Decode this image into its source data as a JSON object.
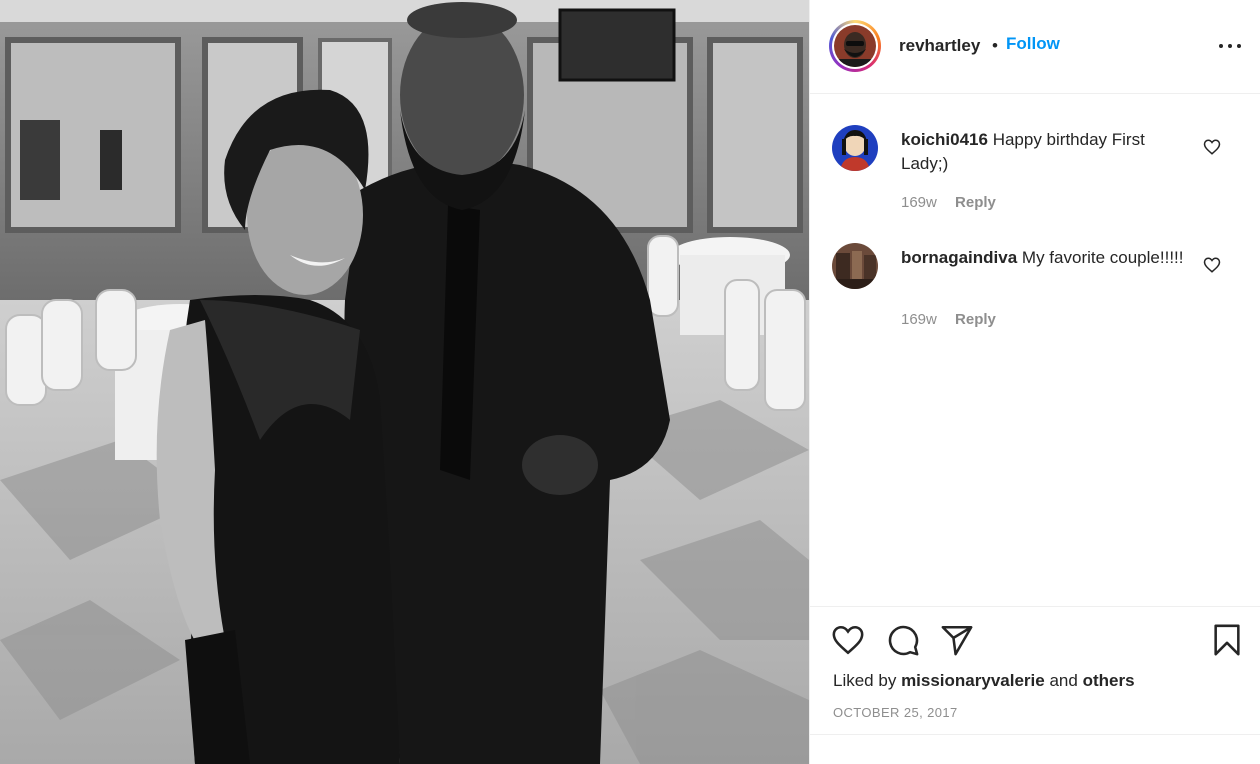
{
  "post": {
    "photo_alt": "",
    "author": {
      "username": "revhartley",
      "separator": "•",
      "follow_label": "Follow"
    },
    "comments": [
      {
        "username": "koichi0416",
        "text": "Happy birthday First Lady;)",
        "age": "169w",
        "reply_label": "Reply"
      },
      {
        "username": "bornagaindiva",
        "text": "My favorite couple!!!!!",
        "age": "169w",
        "reply_label": "Reply"
      }
    ],
    "likes": {
      "prefix": "Liked by",
      "user": "missionaryvalerie",
      "joiner": "and",
      "others": "others"
    },
    "date": "OCTOBER 25, 2017"
  },
  "icons": {
    "more": "more-options-icon",
    "like": "heart-icon",
    "comment": "comment-bubble-icon",
    "share": "paper-plane-icon",
    "save": "bookmark-icon",
    "comment_like": "small-heart-icon"
  },
  "colors": {
    "accent": "#0095f6",
    "text": "#262626",
    "muted": "#8e8e8e",
    "divider": "#efefef"
  }
}
